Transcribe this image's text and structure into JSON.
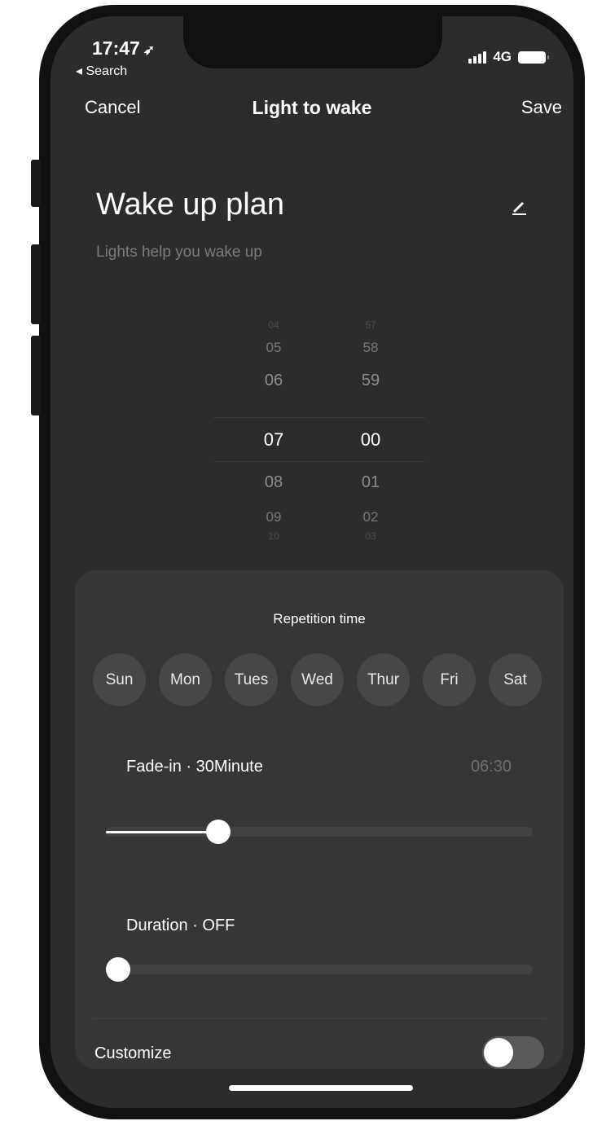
{
  "status_bar": {
    "time": "17:47",
    "back_label": "◂ Search",
    "network": "4G"
  },
  "nav": {
    "cancel": "Cancel",
    "title": "Light to wake",
    "save": "Save"
  },
  "plan": {
    "title": "Wake up plan",
    "subtitle": "Lights help you wake up"
  },
  "time_picker": {
    "hours": [
      "04",
      "05",
      "06",
      "07",
      "08",
      "09",
      "10"
    ],
    "minutes": [
      "57",
      "58",
      "59",
      "00",
      "01",
      "02",
      "03"
    ],
    "selected_hour": "07",
    "selected_minute": "00"
  },
  "repetition": {
    "title": "Repetition time",
    "days": [
      "Sun",
      "Mon",
      "Tues",
      "Wed",
      "Thur",
      "Fri",
      "Sat"
    ]
  },
  "fade_in": {
    "label": "Fade-in · 30Minute",
    "time": "06:30",
    "level_fraction": 0.263
  },
  "duration": {
    "label": "Duration · OFF",
    "level_fraction": 0
  },
  "customize": {
    "label": "Customize",
    "enabled": false
  },
  "colors": {
    "background": "#2c2c2c",
    "panel": "#363636",
    "text": "#ffffff",
    "muted": "#7a7a7a"
  }
}
